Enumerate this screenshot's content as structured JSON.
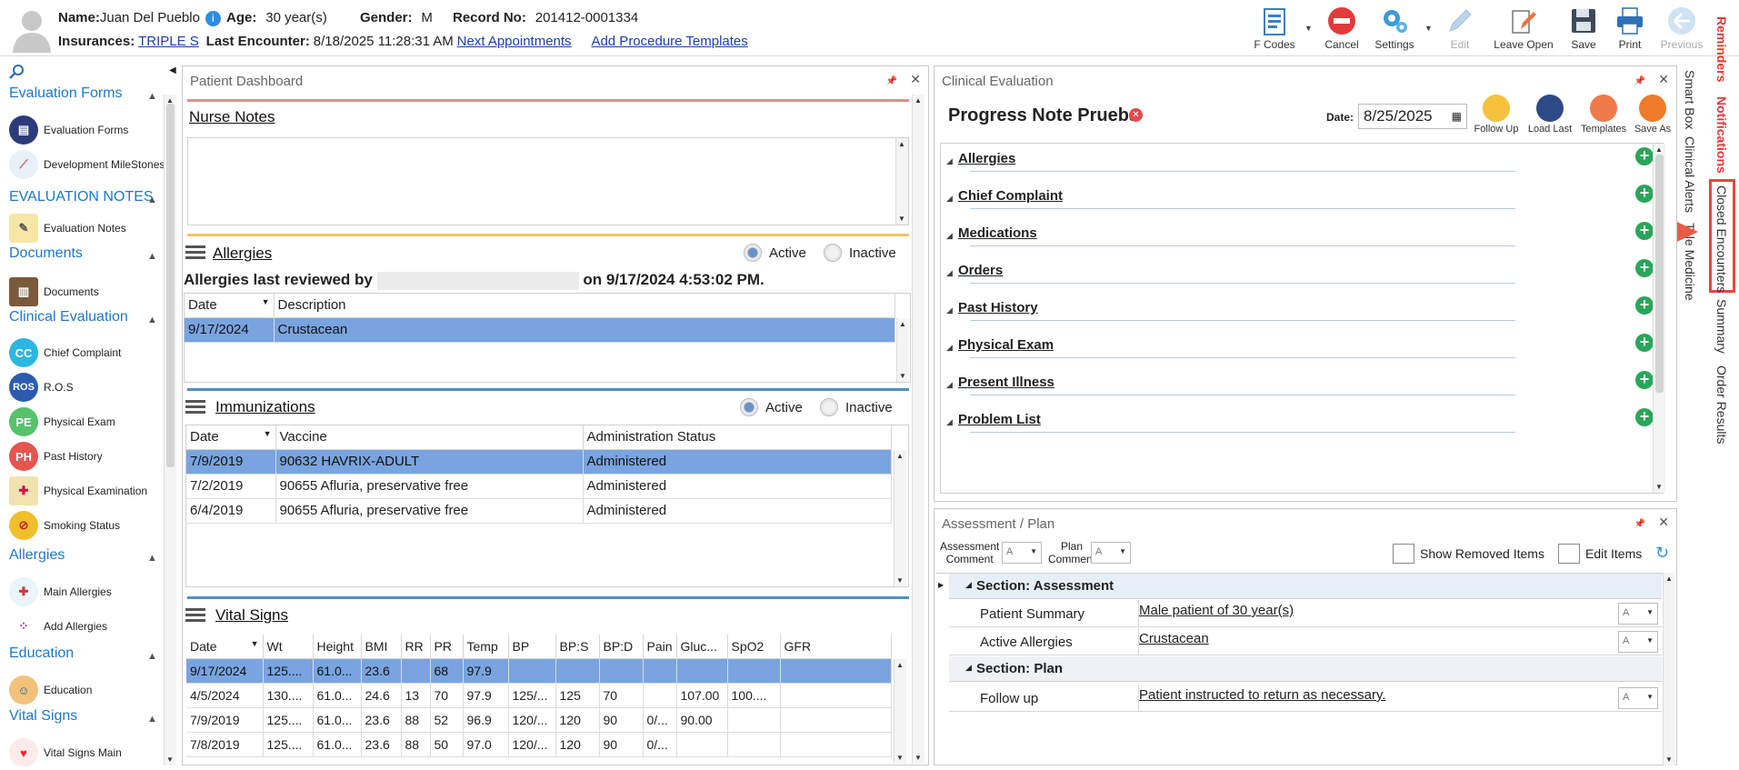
{
  "patient": {
    "name_label": "Name:",
    "name": "Juan Del Pueblo",
    "age_label": "Age:",
    "age": "30 year(s)",
    "gender_label": "Gender:",
    "gender": "M",
    "record_label": "Record No:",
    "record": "201412-0001334",
    "insurances_label": "Insurances:",
    "insurance": "TRIPLE S",
    "last_encounter_label": "Last Encounter:",
    "last_encounter": "8/18/2025 11:28:31 AM",
    "next_appointments": "Next Appointments",
    "add_procedure_templates": "Add Procedure Templates"
  },
  "toolbar": {
    "fcodes": "F Codes",
    "cancel": "Cancel",
    "settings": "Settings",
    "edit": "Edit",
    "leave_open": "Leave Open",
    "save": "Save",
    "print": "Print",
    "previous": "Previous"
  },
  "right_tabs": {
    "reminders": "Reminders",
    "notifications": "Notifications",
    "closed_encounters": "Closed Encounters",
    "summary": "Summary",
    "order_results": "Order Results",
    "smart_box": "Smart Box",
    "clinical_alerts": "Clinical Alerts",
    "telemedicine": "Tele Medicine"
  },
  "sidebar": {
    "groups": [
      {
        "title": "Evaluation Forms",
        "items": [
          "Evaluation Forms",
          "Development MileStones"
        ]
      },
      {
        "title": "EVALUATION NOTES",
        "items": [
          "Evaluation Notes"
        ]
      },
      {
        "title": "Documents",
        "items": [
          "Documents"
        ]
      },
      {
        "title": "Clinical Evaluation",
        "items": [
          "Chief Complaint",
          "R.O.S",
          "Physical Exam",
          "Past History",
          "Physical Examination",
          "Smoking Status"
        ]
      },
      {
        "title": "Allergies",
        "items": [
          "Main Allergies",
          "Add Allergies"
        ]
      },
      {
        "title": "Education",
        "items": [
          "Education"
        ]
      },
      {
        "title": "Vital Signs",
        "items": [
          "Vital Signs Main"
        ]
      }
    ],
    "icon_letters": {
      "cc": "CC",
      "ros": "ROS",
      "pe": "PE",
      "ph": "PH"
    }
  },
  "dashboard": {
    "title": "Patient Dashboard",
    "nurse_notes": "Nurse Notes",
    "allergies": {
      "title": "Allergies",
      "active": "Active",
      "inactive": "Inactive",
      "reviewed_prefix": "Allergies last reviewed by",
      "reviewed_suffix": "on 9/17/2024 4:53:02 PM.",
      "headers": [
        "Date",
        "Description"
      ],
      "rows": [
        [
          "9/17/2024",
          "Crustacean"
        ]
      ]
    },
    "immunizations": {
      "title": "Immunizations",
      "active": "Active",
      "inactive": "Inactive",
      "headers": [
        "Date",
        "Vaccine",
        "Administration Status"
      ],
      "rows": [
        [
          "7/9/2019",
          "90632 HAVRIX-ADULT",
          "Administered"
        ],
        [
          "7/2/2019",
          "90655 Afluria, preservative free",
          "Administered"
        ],
        [
          "6/4/2019",
          "90655 Afluria, preservative free",
          "Administered"
        ]
      ]
    },
    "vitals": {
      "title": "Vital Signs",
      "headers": [
        "Date",
        "Wt",
        "Height",
        "BMI",
        "RR",
        "PR",
        "Temp",
        "BP",
        "BP:S",
        "BP:D",
        "Pain",
        "Gluc...",
        "SpO2",
        "GFR"
      ],
      "rows": [
        [
          "9/17/2024",
          "125....",
          "61.0...",
          "23.6",
          "",
          "68",
          "97.9",
          "",
          "",
          "",
          "",
          "",
          "",
          ""
        ],
        [
          "4/5/2024",
          "130....",
          "61.0...",
          "24.6",
          "13",
          "70",
          "97.9",
          "125/...",
          "125",
          "70",
          "",
          "107.00",
          "100....",
          ""
        ],
        [
          "7/9/2019",
          "125....",
          "61.0...",
          "23.6",
          "88",
          "52",
          "96.9",
          "120/...",
          "120",
          "90",
          "0/...",
          "90.00",
          "",
          ""
        ],
        [
          "7/8/2019",
          "125....",
          "61.0...",
          "23.6",
          "88",
          "50",
          "97.0",
          "120/...",
          "120",
          "90",
          "0/...",
          "",
          "",
          ""
        ]
      ]
    }
  },
  "clinical": {
    "title": "Clinical Evaluation",
    "note_title": "Progress Note Prueba",
    "date_label": "Date:",
    "date": "8/25/2025",
    "tools": [
      "Follow Up",
      "Load Last",
      "Templates",
      "Save As"
    ],
    "sections": [
      "Allergies",
      "Chief Complaint",
      "Medications",
      "Orders",
      "Past History",
      "Physical Exam",
      "Present Illness",
      "Problem List"
    ]
  },
  "assessment": {
    "title": "Assessment / Plan",
    "comment_label1": "Assessment",
    "comment_label2": "Comment",
    "plan_label1": "Plan",
    "plan_label2": "Comment",
    "show_removed": "Show Removed Items",
    "edit_items": "Edit Items",
    "section_assessment": "Section: Assessment",
    "section_plan": "Section: Plan",
    "rows": [
      {
        "label": "Patient Summary",
        "value": "Male patient of 30 year(s)"
      },
      {
        "label": "Active Allergies",
        "value": "Crustacean"
      },
      {
        "label": "Follow up",
        "value": "Patient instructed to return as necessary."
      }
    ]
  },
  "colors": {
    "link": "#1a3fae",
    "sidebar_head": "#1f78c8",
    "selected_row": "#79a4e0",
    "alert_red": "#e53935",
    "plus_green": "#2aa65a"
  }
}
